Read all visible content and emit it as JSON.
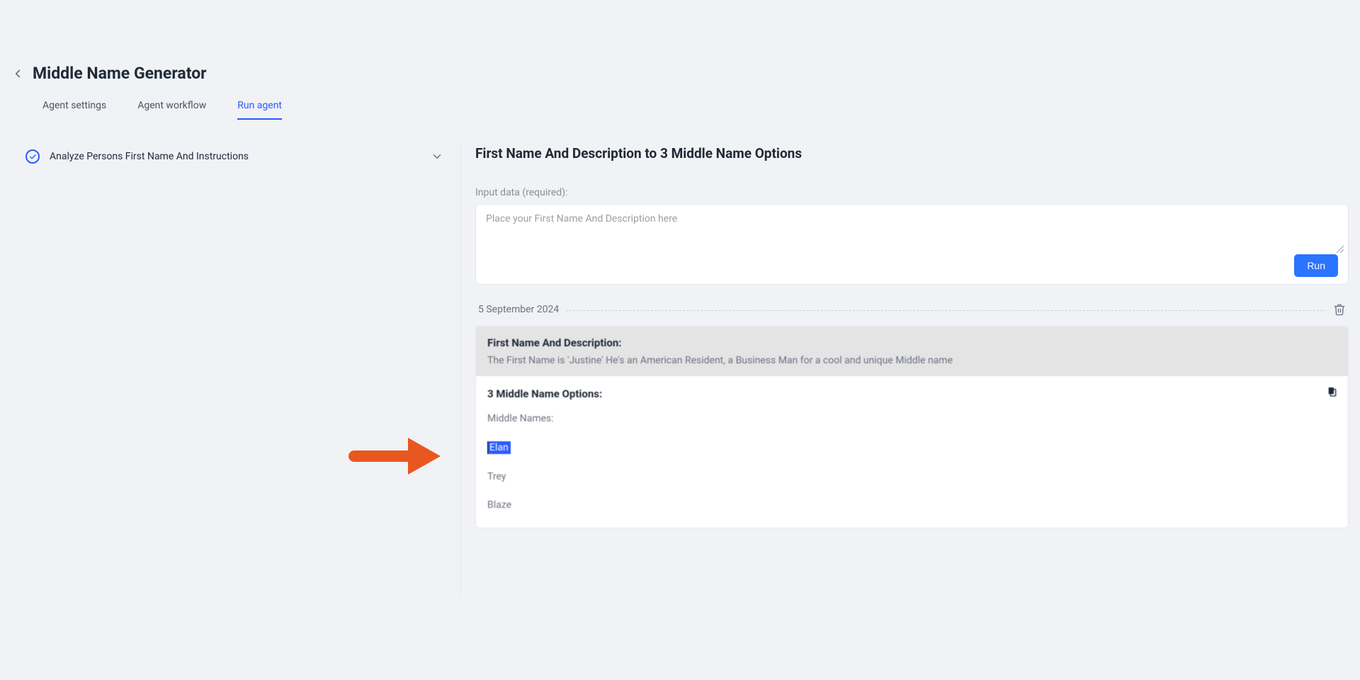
{
  "header": {
    "title": "Middle Name Generator"
  },
  "tabs": [
    {
      "label": "Agent settings",
      "active": false
    },
    {
      "label": "Agent workflow",
      "active": false
    },
    {
      "label": "Run agent",
      "active": true
    }
  ],
  "steps": [
    {
      "label": "Analyze Persons First Name And Instructions"
    }
  ],
  "panel": {
    "title": "First Name And Description to 3 Middle Name Options",
    "input_label": "Input data (required):",
    "input_placeholder": "Place your First Name And Description here",
    "run_label": "Run"
  },
  "history": {
    "date": "5 September 2024",
    "entry": {
      "input_head": "First Name And Description:",
      "input_body": "The First Name is 'Justine' He's an American Resident, a Business Man for a cool and unique Middle name",
      "output_head": "3 Middle Name Options:",
      "options_label": "Middle Names:",
      "options": [
        "Elan",
        "Trey",
        "Blaze"
      ],
      "selected_index": 0
    }
  },
  "colors": {
    "accent": "#2a5bff",
    "run_button": "#2a74ff",
    "arrow": "#e8571f"
  }
}
